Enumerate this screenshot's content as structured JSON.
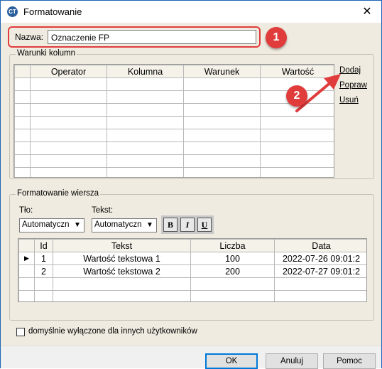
{
  "window": {
    "title": "Formatowanie",
    "close_glyph": "✕",
    "icon_text": "CT"
  },
  "name_field": {
    "label": "Nazwa:",
    "value": "Oznaczenie FP"
  },
  "annotations": [
    "1",
    "2"
  ],
  "column_conditions": {
    "title": "Warunki kolumn",
    "headers": [
      "Operator",
      "Kolumna",
      "Warunek",
      "Wartość"
    ],
    "actions": [
      "Dodaj",
      "Popraw",
      "Usuń"
    ]
  },
  "row_format": {
    "title": "Formatowanie wiersza",
    "background_label": "Tło:",
    "background_value": "Automatyczny",
    "text_label": "Tekst:",
    "text_value": "Automatyczny",
    "bold": "B",
    "italic": "I",
    "underline": "U",
    "preview_headers": [
      "Id",
      "Tekst",
      "Liczba",
      "Data"
    ],
    "preview_rows": [
      [
        "1",
        "Wartość tekstowa 1",
        "100",
        "2022-07-26 09:01:2"
      ],
      [
        "2",
        "Wartość tekstowa 2",
        "200",
        "2022-07-27 09:01:2"
      ]
    ]
  },
  "disable_checkbox": {
    "label": "domyślnie wyłączone dla innych użytkowników",
    "checked": false
  },
  "buttons": {
    "ok": "OK",
    "cancel": "Anuluj",
    "help": "Pomoc"
  },
  "colors": {
    "accent_red": "#e03c3c",
    "title_border": "#1e64b4"
  }
}
